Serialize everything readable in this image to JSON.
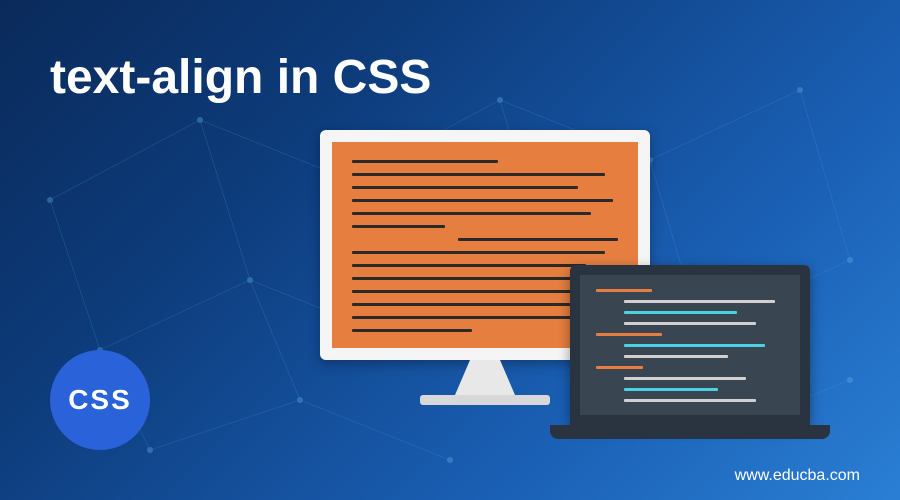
{
  "title": "text-align in CSS",
  "badge": {
    "label": "CSS"
  },
  "footer": {
    "url": "www.educba.com"
  },
  "colors": {
    "monitor_screen": "#e67e40",
    "laptop_screen": "#3a4552",
    "badge_bg": "#2962d9",
    "background_start": "#0a2a5a",
    "background_end": "#2a7fd4"
  }
}
